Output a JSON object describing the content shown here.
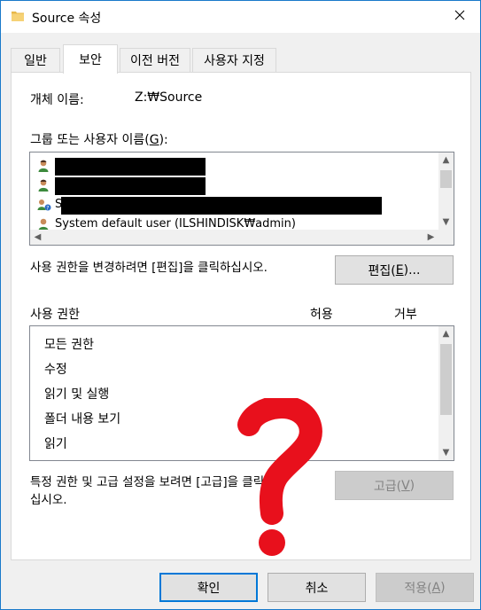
{
  "window": {
    "title": "Source 속성",
    "close_icon": "close-icon",
    "folder_icon": "folder-icon"
  },
  "tabs": [
    {
      "label": "일반",
      "active": false
    },
    {
      "label": "보안",
      "active": true
    },
    {
      "label": "이전 버전",
      "active": false
    },
    {
      "label": "사용자 지정",
      "active": false
    }
  ],
  "security": {
    "object_name_label": "개체 이름:",
    "object_name_value": "Z:₩Source",
    "group_label_prefix": "그룹 또는 사용자 이름(",
    "group_label_key": "G",
    "group_label_suffix": "):",
    "users": [
      {
        "text": "",
        "redacted": true
      },
      {
        "text": "",
        "redacted": true
      },
      {
        "text": "S",
        "redacted": true
      },
      {
        "text": "System default user (ILSHINDISK₩admin)",
        "redacted": false
      }
    ],
    "edit_hint": "사용 권한을 변경하려면 [편집]을 클릭하십시오.",
    "edit_button": {
      "prefix": "편집(",
      "key": "E",
      "suffix": ")..."
    },
    "permissions_header": "사용 권한",
    "allow_header": "허용",
    "deny_header": "거부",
    "permissions": [
      "모든 권한",
      "수정",
      "읽기 및 실행",
      "폴더 내용 보기",
      "읽기"
    ],
    "advanced_hint_line1": "특정 권한 및 고급 설정을 보려면 [고급]을 클릭하",
    "advanced_hint_line2": "십시오.",
    "advanced_button": {
      "prefix": "고급(",
      "key": "V",
      "suffix": ")"
    }
  },
  "footer": {
    "ok_label": "확인",
    "cancel_label": "취소",
    "apply_prefix": "적용(",
    "apply_key": "A",
    "apply_suffix": ")"
  },
  "overlay": {
    "question_mark_color": "#e8101c"
  },
  "colors": {
    "accent": "#0078d7",
    "disabled_text": "#838383"
  }
}
